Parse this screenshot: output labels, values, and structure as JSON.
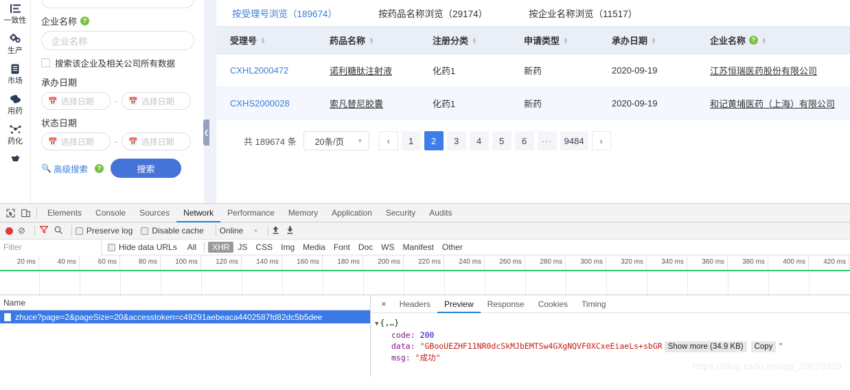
{
  "sidebar_rail": {
    "items": [
      {
        "label": "一致性",
        "icon": "list-bars-icon",
        "glyph": "≡"
      },
      {
        "label": "生产",
        "icon": "gears-icon",
        "glyph": "⚙"
      },
      {
        "label": "市场",
        "icon": "document-icon",
        "glyph": "▤"
      },
      {
        "label": "用药",
        "icon": "capsule-icon",
        "glyph": "⚲"
      },
      {
        "label": "药化",
        "icon": "molecule-icon",
        "glyph": "⁂"
      },
      {
        "label": "",
        "icon": "mortar-icon",
        "glyph": "☗"
      }
    ]
  },
  "filter_panel": {
    "company_label": "企业名称",
    "company_help": "?",
    "company_placeholder": "企业名称",
    "checkbox_label": "搜索该企业及相关公司所有数据",
    "handle_date_label": "承办日期",
    "status_date_label": "状态日期",
    "date_placeholder": "选择日期",
    "date_separator": "-",
    "advanced_search": "高级搜索",
    "advanced_help": "?",
    "search_button": "搜索"
  },
  "results": {
    "tabs": [
      {
        "label": "按受理号浏览（189674）",
        "active": true
      },
      {
        "label": "按药品名称浏览（29174）",
        "active": false
      },
      {
        "label": "按企业名称浏览（11517）",
        "active": false
      }
    ],
    "columns": [
      {
        "label": "受理号",
        "sortable": true,
        "help": false
      },
      {
        "label": "药品名称",
        "sortable": true,
        "help": false
      },
      {
        "label": "注册分类",
        "sortable": true,
        "help": false
      },
      {
        "label": "申请类型",
        "sortable": true,
        "help": false
      },
      {
        "label": "承办日期",
        "sortable": true,
        "help": false
      },
      {
        "label": "企业名称",
        "sortable": true,
        "help": true
      }
    ],
    "rows": [
      {
        "accept_no": "CXHL2000472",
        "drug_name": "诺利糖肽注射液",
        "reg_class": "化药1",
        "apply_type": "新药",
        "handle_date": "2020-09-19",
        "company": "江苏恒瑞医药股份有限公司"
      },
      {
        "accept_no": "CXHS2000028",
        "drug_name": "索凡替尼胶囊",
        "reg_class": "化药1",
        "apply_type": "新药",
        "handle_date": "2020-09-19",
        "company": "和记黄埔医药（上海）有限公司"
      }
    ],
    "pagination": {
      "total_text": "共 189674 条",
      "page_size": "20条/页",
      "prev": "‹",
      "next": "›",
      "pages": [
        "1",
        "2",
        "3",
        "4",
        "5",
        "6"
      ],
      "ellipsis": "···",
      "last_page": "9484",
      "current": "2"
    }
  },
  "devtools": {
    "panel_tabs": [
      {
        "label": "Elements",
        "active": false
      },
      {
        "label": "Console",
        "active": false
      },
      {
        "label": "Sources",
        "active": false
      },
      {
        "label": "Network",
        "active": true
      },
      {
        "label": "Performance",
        "active": false
      },
      {
        "label": "Memory",
        "active": false
      },
      {
        "label": "Application",
        "active": false
      },
      {
        "label": "Security",
        "active": false
      },
      {
        "label": "Audits",
        "active": false
      }
    ],
    "toolbar": {
      "record_title": "record",
      "clear_glyph": "⊘",
      "filter_glyph": "▼",
      "search_glyph": "⌕",
      "preserve_log": "Preserve log",
      "disable_cache": "Disable cache",
      "throttling": "Online",
      "throttling_caret": "▾",
      "upload_glyph": "⬆",
      "download_glyph": "⬇"
    },
    "filterbar": {
      "filter_placeholder": "Filter",
      "hide_data_urls": "Hide data URLs",
      "types": [
        {
          "label": "All",
          "selected": false
        },
        {
          "label": "XHR",
          "selected": true
        },
        {
          "label": "JS",
          "selected": false
        },
        {
          "label": "CSS",
          "selected": false
        },
        {
          "label": "Img",
          "selected": false
        },
        {
          "label": "Media",
          "selected": false
        },
        {
          "label": "Font",
          "selected": false
        },
        {
          "label": "Doc",
          "selected": false
        },
        {
          "label": "WS",
          "selected": false
        },
        {
          "label": "Manifest",
          "selected": false
        },
        {
          "label": "Other",
          "selected": false
        }
      ]
    },
    "timeline": {
      "ticks": [
        "20 ms",
        "40 ms",
        "60 ms",
        "80 ms",
        "100 ms",
        "120 ms",
        "140 ms",
        "160 ms",
        "180 ms",
        "200 ms",
        "220 ms",
        "240 ms",
        "260 ms",
        "280 ms",
        "300 ms",
        "320 ms",
        "340 ms",
        "360 ms",
        "380 ms",
        "400 ms",
        "420 ms"
      ]
    },
    "request_list": {
      "header": "Name",
      "rows": [
        {
          "name": "zhuce?page=2&pageSize=20&accesstoken=c49291aebeaca4402587fd82dc5b5dee",
          "selected": true
        }
      ]
    },
    "detail": {
      "close": "×",
      "tabs": [
        {
          "label": "Headers",
          "active": false
        },
        {
          "label": "Preview",
          "active": true
        },
        {
          "label": "Response",
          "active": false
        },
        {
          "label": "Cookies",
          "active": false
        },
        {
          "label": "Timing",
          "active": false
        }
      ],
      "preview": {
        "root": "{,…}",
        "code_key": "code:",
        "code_value": "200",
        "data_key": "data:",
        "data_value_open": "\"GBooUEZHF11NR0dcSkMJbEMTSw4GXgNQVF0XCxeEiaeLs+sbGR",
        "show_more": "Show more (34.9 KB)",
        "copy": "Copy",
        "data_value_close": "\"",
        "msg_key": "msg:",
        "msg_value": "\"成功\""
      }
    }
  },
  "watermark": "https://blog.csdn.net/qq_26079939",
  "colors": {
    "accent_blue": "#3d7eea",
    "link_blue": "#3a7fd5",
    "header_bg": "#eaeef7",
    "row_alt": "#f4f7fd",
    "devtools_tab_active": "#1a7fd4",
    "record_red": "#e03a3a",
    "timeline_green": "#2fcc6e",
    "help_green": "#7ac143"
  }
}
